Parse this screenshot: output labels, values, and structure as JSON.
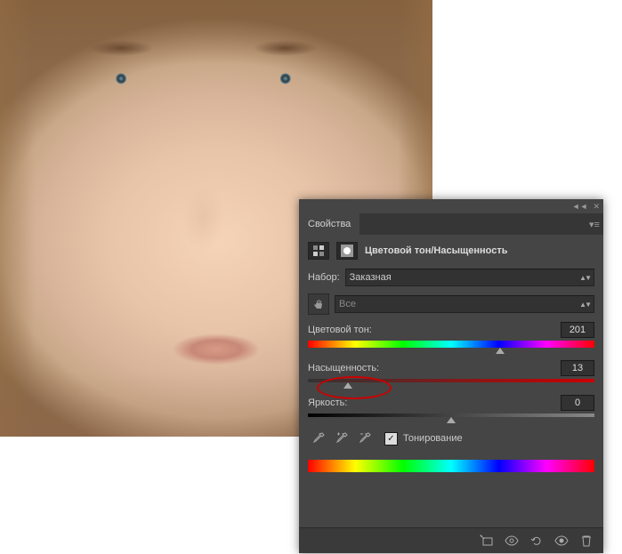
{
  "panel": {
    "tab_title": "Свойства",
    "adjustment_name": "Цветовой тон/Насыщенность",
    "preset_label": "Набор:",
    "preset_value": "Заказная",
    "channel_value": "Все",
    "sliders": {
      "hue": {
        "label": "Цветовой тон:",
        "value": "201",
        "position": 67
      },
      "saturation": {
        "label": "Насыщенность:",
        "value": "13",
        "position": 14
      },
      "lightness": {
        "label": "Яркость:",
        "value": "0",
        "position": 50
      }
    },
    "colorize_label": "Тонирование",
    "colorize_checked": true
  }
}
